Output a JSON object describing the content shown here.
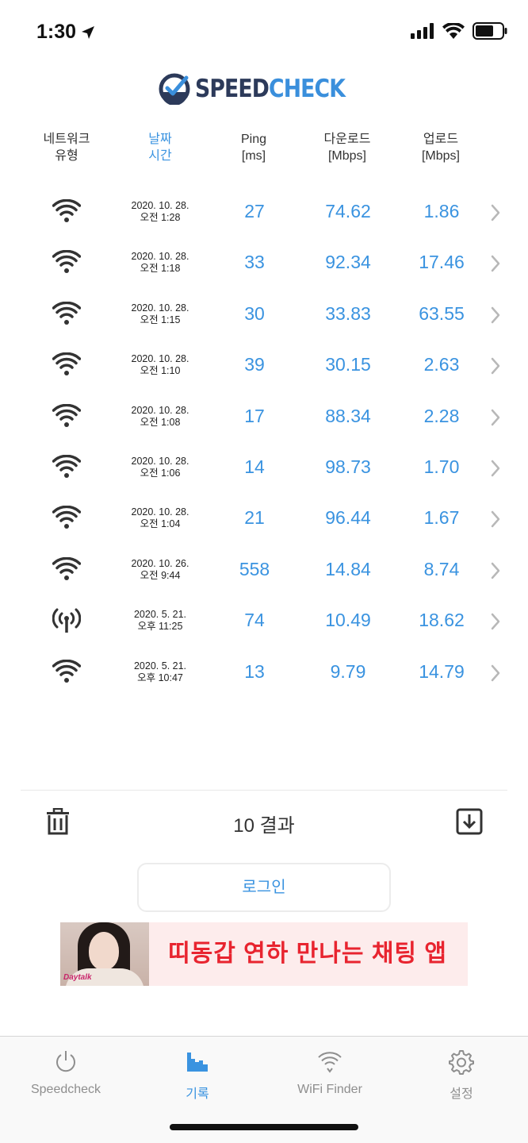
{
  "status_bar": {
    "time": "1:30",
    "icons": [
      "location-arrow-icon",
      "cellular-signal-icon",
      "wifi-icon",
      "battery-icon"
    ]
  },
  "app": {
    "logo_part1": "SPEED",
    "logo_part2": "CHECK",
    "accent_color": "#3a93e0",
    "logo_dark_color": "#2c3a5a"
  },
  "header": {
    "network_type": "네트워크\n유형",
    "date_time": "날짜\n시간",
    "ping": "Ping\n[ms]",
    "download": "다운로드\n[Mbps]",
    "upload": "업로드\n[Mbps]"
  },
  "results": [
    {
      "type": "wifi",
      "date": "2020. 10. 28.",
      "time": "오전 1:28",
      "ping": "27",
      "download": "74.62",
      "upload": "1.86"
    },
    {
      "type": "wifi",
      "date": "2020. 10. 28.",
      "time": "오전 1:18",
      "ping": "33",
      "download": "92.34",
      "upload": "17.46"
    },
    {
      "type": "wifi",
      "date": "2020. 10. 28.",
      "time": "오전 1:15",
      "ping": "30",
      "download": "33.83",
      "upload": "63.55"
    },
    {
      "type": "wifi",
      "date": "2020. 10. 28.",
      "time": "오전 1:10",
      "ping": "39",
      "download": "30.15",
      "upload": "2.63"
    },
    {
      "type": "wifi",
      "date": "2020. 10. 28.",
      "time": "오전 1:08",
      "ping": "17",
      "download": "88.34",
      "upload": "2.28"
    },
    {
      "type": "wifi",
      "date": "2020. 10. 28.",
      "time": "오전 1:06",
      "ping": "14",
      "download": "98.73",
      "upload": "1.70"
    },
    {
      "type": "wifi",
      "date": "2020. 10. 28.",
      "time": "오전 1:04",
      "ping": "21",
      "download": "96.44",
      "upload": "1.67"
    },
    {
      "type": "wifi",
      "date": "2020. 10. 26.",
      "time": "오전 9:44",
      "ping": "558",
      "download": "14.84",
      "upload": "8.74"
    },
    {
      "type": "cellular",
      "date": "2020. 5. 21.",
      "time": "오후 11:25",
      "ping": "74",
      "download": "10.49",
      "upload": "18.62"
    },
    {
      "type": "wifi",
      "date": "2020. 5. 21.",
      "time": "오후 10:47",
      "ping": "13",
      "download": "9.79",
      "upload": "14.79"
    }
  ],
  "footer": {
    "result_count": "10 결과",
    "login_label": "로그인"
  },
  "ad": {
    "text": "띠동갑 연하 만나는 채팅 앱",
    "brand": "Daytalk"
  },
  "tabs": [
    {
      "label": "Speedcheck",
      "icon": "power-icon",
      "active": false
    },
    {
      "label": "기록",
      "icon": "history-chart-icon",
      "active": true
    },
    {
      "label": "WiFi Finder",
      "icon": "wifi-finder-icon",
      "active": false
    },
    {
      "label": "설정",
      "icon": "gear-icon",
      "active": false
    }
  ]
}
